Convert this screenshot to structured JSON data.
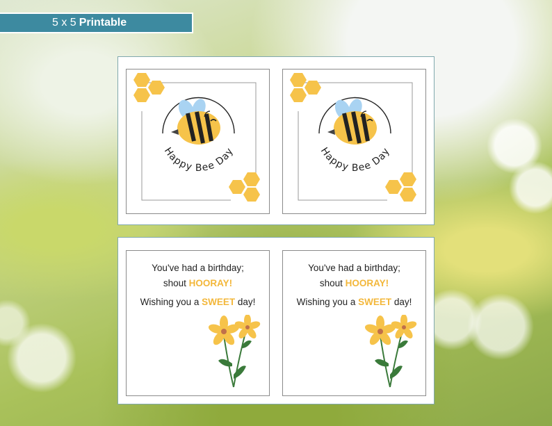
{
  "banner": {
    "size": "5 x 5",
    "label": "Printable"
  },
  "front_cards": [
    {
      "greeting": "Happy Bee Day"
    },
    {
      "greeting": "Happy Bee Day"
    }
  ],
  "back_cards": [
    {
      "line1": "You've had a birthday;",
      "line2_pre": "shout ",
      "line2_hl": "HOORAY!",
      "line3_pre": "Wishing you a ",
      "line3_hl": "SWEET",
      "line3_post": " day!"
    },
    {
      "line1": "You've had a birthday;",
      "line2_pre": "shout ",
      "line2_hl": "HOORAY!",
      "line3_pre": "Wishing you a ",
      "line3_hl": "SWEET",
      "line3_post": " day!"
    }
  ],
  "colors": {
    "banner": "#3d8aa0",
    "honeycomb": "#f6c34a",
    "bee_body": "#f6c34a",
    "wings": "#a9d3f2",
    "highlight": "#f3b73a",
    "flower": "#f6c34a",
    "stem": "#3a7a3a"
  },
  "icons": [
    "bee-illustration",
    "honeycomb-icon",
    "flower-illustration"
  ]
}
